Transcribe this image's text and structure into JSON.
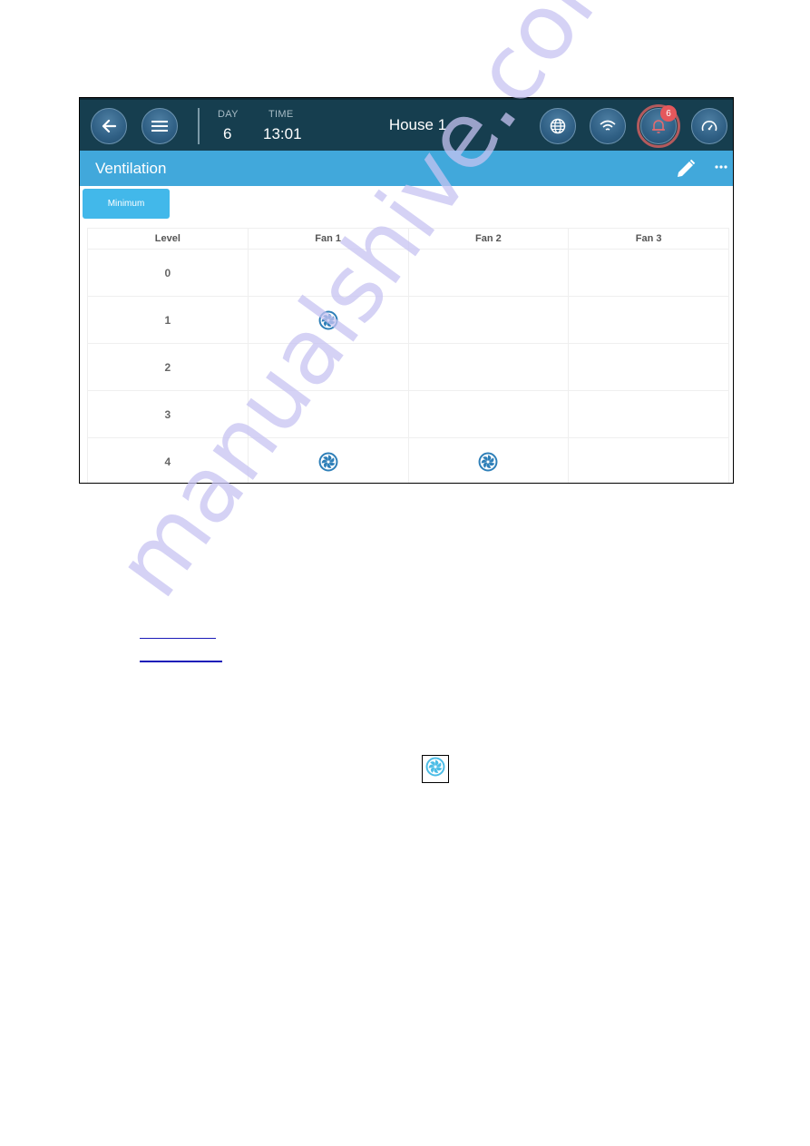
{
  "topbar": {
    "day_label": "DAY",
    "day_value": "6",
    "time_label": "TIME",
    "time_value": "13:01",
    "house_title": "House 1",
    "alarm_count": "6",
    "icons": [
      "back-arrow-icon",
      "menu-icon",
      "globe-icon",
      "wifi-icon",
      "bell-icon",
      "gauge-icon"
    ]
  },
  "header": {
    "title": "Ventilation",
    "icons": [
      "edit-pencil-icon",
      "more-dots-icon"
    ]
  },
  "tabs": [
    {
      "label": "Minimum",
      "active": true
    }
  ],
  "table": {
    "columns": [
      "Level",
      "Fan 1",
      "Fan 2",
      "Fan 3"
    ],
    "rows": [
      {
        "level": "0",
        "fan1": false,
        "fan2": false,
        "fan3": false
      },
      {
        "level": "1",
        "fan1": true,
        "fan2": false,
        "fan3": false
      },
      {
        "level": "2",
        "fan1": false,
        "fan2": false,
        "fan3": false
      },
      {
        "level": "3",
        "fan1": false,
        "fan2": false,
        "fan3": false
      },
      {
        "level": "4",
        "fan1": true,
        "fan2": true,
        "fan3": false
      }
    ]
  },
  "colors": {
    "topbar": "#163e4f",
    "header": "#41a8db",
    "tab_active": "#42b8ea",
    "fan_icon": "#2e7fb8",
    "fan_icon_light": "#4cbde6",
    "alarm_badge": "#e5585c",
    "link": "#1a1ab8"
  },
  "page": {
    "links": [
      "link-1",
      "link-2"
    ],
    "standalone_icon": "fan-icon",
    "watermark": "manualshive.com"
  }
}
